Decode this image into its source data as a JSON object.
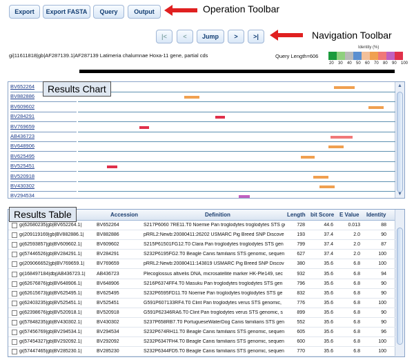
{
  "operation_toolbar": {
    "buttons": [
      "Export",
      "Export FASTA",
      "Query",
      "Output"
    ],
    "callout": "Operation Toolbar"
  },
  "navigation_toolbar": {
    "buttons": [
      "|<",
      "<",
      "Jump",
      ">",
      ">|"
    ],
    "callout": "Navigation Toolbar"
  },
  "query": {
    "description": "gi|11611818|gb|AF287139.1|AF287139 Latimeria chalumnae Hoxa-11 gene, partial cds",
    "length_label": "Query Length=606"
  },
  "identity_legend": {
    "title": "Identity (%)",
    "labels": [
      "20",
      "30",
      "40",
      "50",
      "60",
      "70",
      "80",
      "90",
      "100"
    ],
    "colors": [
      "#1a9a3c",
      "#8fd07e",
      "#b9b9b9",
      "#5a8fd0",
      "#f3c09a",
      "#f0a050",
      "#f07878",
      "#c060c0",
      "#e0304a"
    ]
  },
  "results_chart": {
    "label": "Results Chart",
    "rows": [
      {
        "acc": "BV652264",
        "color": "#f0a050"
      },
      {
        "acc": "BV882886",
        "color": "#f0a050"
      },
      {
        "acc": "BV609602",
        "color": "#f0a050"
      },
      {
        "acc": "BV284291",
        "color": "#e0304a"
      },
      {
        "acc": "BV769659",
        "color": "#e0304a"
      },
      {
        "acc": "AB436723",
        "color": "#f07878"
      },
      {
        "acc": "BV648906",
        "color": "#f0a050"
      },
      {
        "acc": "BV625495",
        "color": "#f0a050"
      },
      {
        "acc": "BV525451",
        "color": "#e0304a"
      },
      {
        "acc": "BV520918",
        "color": "#f0a050"
      },
      {
        "acc": "BV430302",
        "color": "#f0a050"
      },
      {
        "acc": "BV294534",
        "color": "#c060c0"
      }
    ]
  },
  "results_table": {
    "label": "Results Table",
    "columns": [
      "Accession",
      "Definition",
      "Length",
      "bit Score",
      "E Value",
      "Identity"
    ],
    "rows": [
      [
        "gi|62680235|gb|BV652264.1|",
        "BV652264",
        "S217P6060 7RE11.T0 Noemie Pan troglodytes troglodytes STS ge",
        "728",
        "44.6",
        "0.013",
        "88"
      ],
      [
        "gi|209119169|gb|BV882886.1|",
        "BV882886",
        "pRRL2:Newb:20080411:26202 USMARC Pig Breed SNP Discove",
        "193",
        "37.4",
        "2.0",
        "90"
      ],
      [
        "gi|62593857|gb|BV609602.1|",
        "BV609602",
        "S215P61501FG12.T0 Clara Pan troglodytes troglodytes STS gen",
        "799",
        "37.4",
        "2.0",
        "87"
      ],
      [
        "gi|57446526|gb|BV284291.1|",
        "BV284291",
        "S232P6195FG2.T0 Beagle Canis familiaris STS genomic, sequen",
        "627",
        "37.4",
        "2.0",
        "100"
      ],
      [
        "gi|209066652|gb|BV769659.1|",
        "BV769659",
        "pRRL2:Newb:20080411:143819 USMARC Pig Breed SNP Discov",
        "380",
        "35.6",
        "6.8",
        "100"
      ],
      [
        "gi|168497184|dbj|AB436723.1|",
        "AB436723",
        "Plecoglossus altivelis DNA, microsatellite marker HK-Ple149, sec",
        "932",
        "35.6",
        "6.8",
        "94"
      ],
      [
        "gi|62676876|gb|BV648906.1|",
        "BV648906",
        "S216P6374FF4.T0 Masuku Pan troglodytes troglodytes STS gen",
        "796",
        "35.6",
        "6.8",
        "90"
      ],
      [
        "gi|62615673|gb|BV625495.1|",
        "BV625495",
        "S232P6595FD11.T0 Noemie Pan troglodytes troglodytes STS ge",
        "832",
        "35.6",
        "6.8",
        "90"
      ],
      [
        "gi|62403235|gb|BV525451.1|",
        "BV525451",
        "G591P607133RF4.T0 Clint Pan troglodytes verus STS genomic,",
        "776",
        "35.6",
        "6.8",
        "100"
      ],
      [
        "gi|62398676|gb|BV520918.1|",
        "BV520918",
        "G591P62346RA6.T0 Clint Pan troglodytes verus STS genomic, s",
        "899",
        "35.6",
        "6.8",
        "90"
      ],
      [
        "gi|57848235|gb|BV430302.1|",
        "BV430302",
        "S237P658RB7.T0 PortugueseWaterDog Canis familiaris STS gen",
        "552",
        "35.6",
        "6.8",
        "90"
      ],
      [
        "gi|57456769|gb|BV294534.1|",
        "BV294534",
        "S232P674RH11.T0 Beagle Canis familiaris STS genomic, sequen",
        "605",
        "35.6",
        "6.8",
        "96"
      ],
      [
        "gi|57454327|gb|BV292092.1|",
        "BV292092",
        "S232P6347FH4.T0 Beagle Canis familiaris STS genomic, sequen",
        "600",
        "35.6",
        "6.8",
        "100"
      ],
      [
        "gi|57447465|gb|BV285230.1|",
        "BV285230",
        "S232P6344FD5.T0 Beagle Canis familiaris STS genomic, sequen",
        "770",
        "35.6",
        "6.8",
        "100"
      ]
    ]
  }
}
